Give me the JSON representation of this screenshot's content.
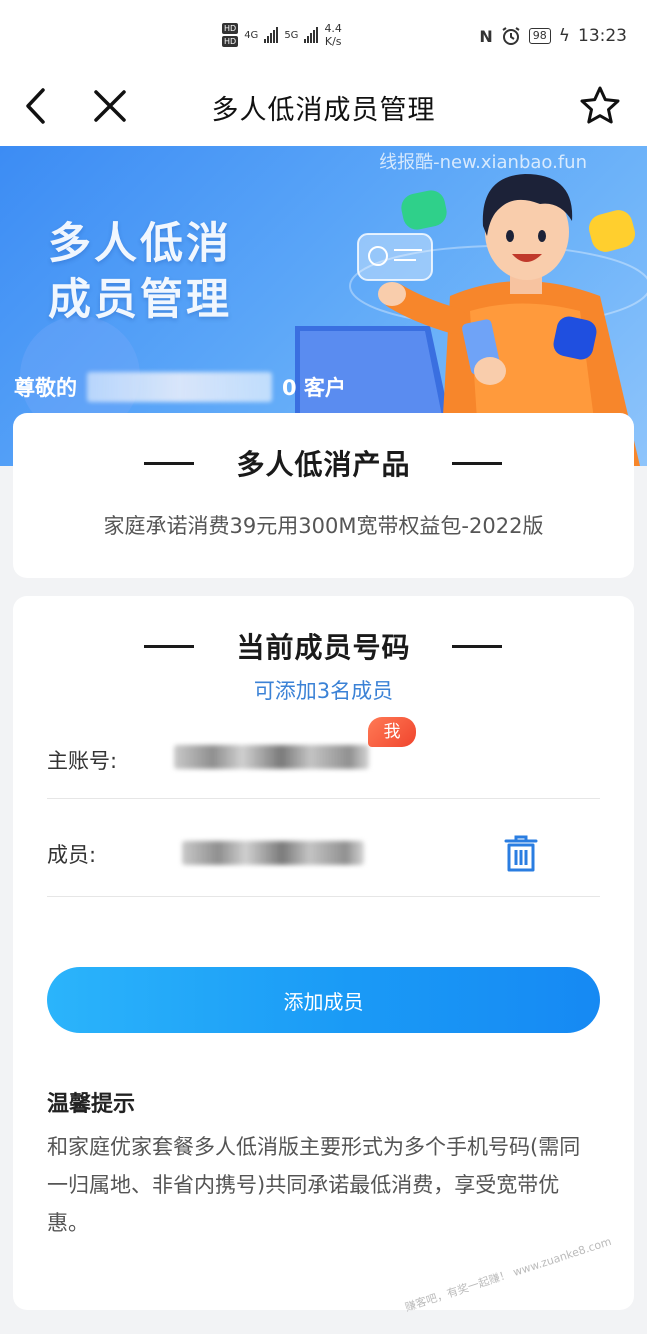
{
  "status_bar": {
    "hd1": "HD",
    "hd2": "HD",
    "net1": "4G",
    "net2": "5G",
    "speed_value": "4.4",
    "speed_unit": "K/s",
    "nfc": "N",
    "battery": "98",
    "time": "13:23"
  },
  "nav": {
    "title": "多人低消成员管理"
  },
  "banner": {
    "watermark": "线报酷-new.xianbao.fun",
    "title_line1": "多人低消",
    "title_line2": "成员管理",
    "greet_prefix": "尊敬的",
    "greet_suffix": "0 客户"
  },
  "product": {
    "section_title": "多人低消产品",
    "name": "家庭承诺消费39元用300M宽带权益包-2022版"
  },
  "members": {
    "section_title": "当前成员号码",
    "available_text": "可添加3名成员",
    "primary_label": "主账号:",
    "me_badge": "我",
    "member_label": "成员:",
    "add_button": "添加成员"
  },
  "tips": {
    "title": "温馨提示",
    "text": "和家庭优家套餐多人低消版主要形式为多个手机号码(需同一归属地、非省内携号)共同承诺最低消费，享受宽带优惠。"
  },
  "footer": {
    "watermark": "赚客吧，有奖一起赚！ www.zuanke8.com"
  },
  "colors": {
    "accent": "#1a9af6",
    "link": "#3b82d6",
    "badge": "#f0452e",
    "banner": "#4b9af6"
  }
}
